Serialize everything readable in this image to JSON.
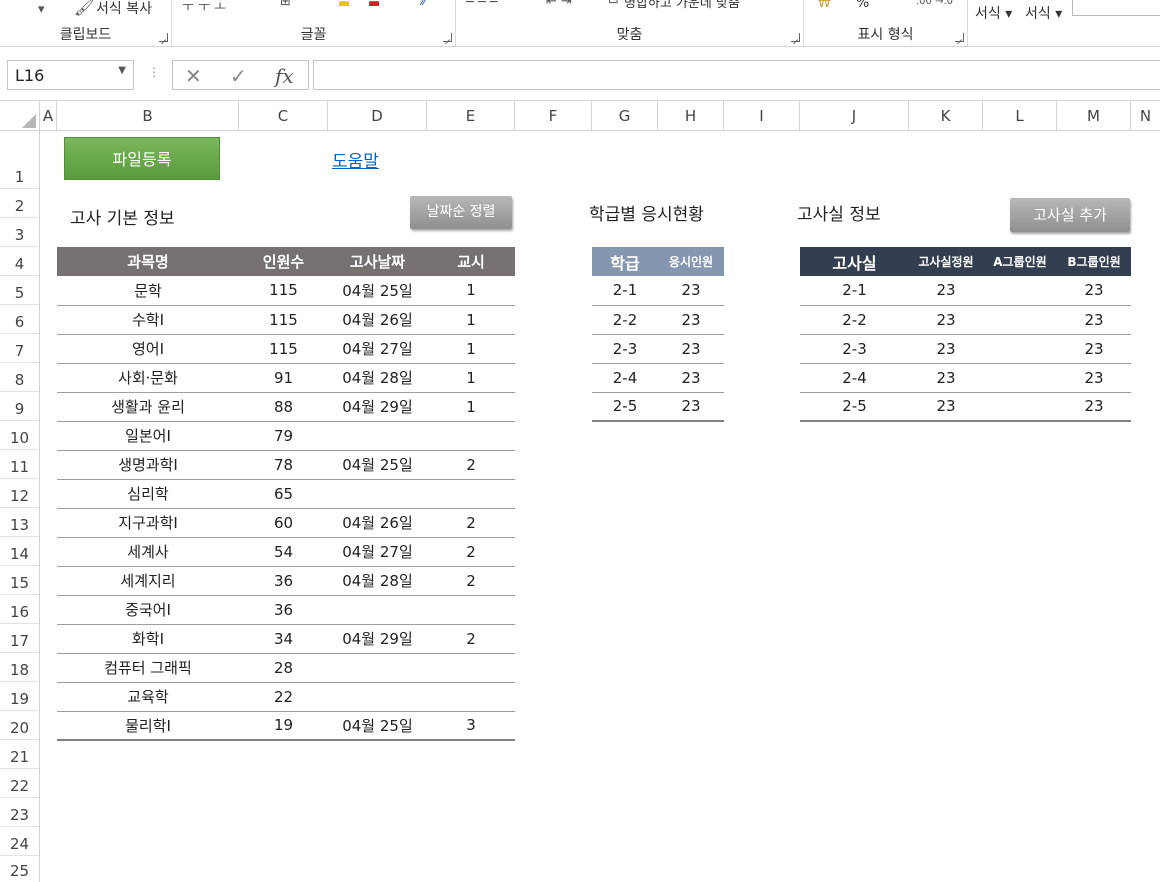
{
  "ribbon": {
    "clipboard_label": "클립보드",
    "font_label": "글꼴",
    "align_label": "맞춤",
    "number_label": "표시 형식",
    "format_painter": "서식 복사",
    "style1": "서식",
    "style2": "서식",
    "merge_label": "병합하고 가운데 맞춤",
    "percent": "%"
  },
  "formula_bar": {
    "name_box": "L16",
    "formula": ""
  },
  "columns": [
    "A",
    "B",
    "C",
    "D",
    "E",
    "F",
    "G",
    "H",
    "I",
    "J",
    "K",
    "L",
    "M",
    "N"
  ],
  "rows": [
    "1",
    "2",
    "3",
    "4",
    "5",
    "6",
    "7",
    "8",
    "9",
    "10",
    "11",
    "12",
    "13",
    "14",
    "15",
    "16",
    "17",
    "18",
    "19",
    "20",
    "21",
    "22",
    "23",
    "24",
    "25"
  ],
  "sheet": {
    "register_button": "파일등록",
    "help_link": "도움말",
    "exam_info_title": "고사 기본 정보",
    "sort_button": "날짜순 정렬",
    "class_status_title": "학급별 응시현황",
    "room_info_title": "고사실 정보",
    "add_room_button": "고사실 추가"
  },
  "exam_table": {
    "headers": [
      "과목명",
      "인원수",
      "고사날짜",
      "교시"
    ],
    "rows": [
      [
        "문학",
        "115",
        "04월 25일",
        "1"
      ],
      [
        "수학Ⅰ",
        "115",
        "04월 26일",
        "1"
      ],
      [
        "영어Ⅰ",
        "115",
        "04월 27일",
        "1"
      ],
      [
        "사회·문화",
        "91",
        "04월 28일",
        "1"
      ],
      [
        "생활과 윤리",
        "88",
        "04월 29일",
        "1"
      ],
      [
        "일본어Ⅰ",
        "79",
        "",
        ""
      ],
      [
        "생명과학Ⅰ",
        "78",
        "04월 25일",
        "2"
      ],
      [
        "심리학",
        "65",
        "",
        ""
      ],
      [
        "지구과학Ⅰ",
        "60",
        "04월 26일",
        "2"
      ],
      [
        "세계사",
        "54",
        "04월 27일",
        "2"
      ],
      [
        "세계지리",
        "36",
        "04월 28일",
        "2"
      ],
      [
        "중국어Ⅰ",
        "36",
        "",
        ""
      ],
      [
        "화학Ⅰ",
        "34",
        "04월 29일",
        "2"
      ],
      [
        "컴퓨터 그래픽",
        "28",
        "",
        ""
      ],
      [
        "교육학",
        "22",
        "",
        ""
      ],
      [
        "물리학Ⅰ",
        "19",
        "04월 25일",
        "3"
      ]
    ]
  },
  "class_table": {
    "headers": [
      "학급",
      "응시인원"
    ],
    "rows": [
      [
        "2-1",
        "23"
      ],
      [
        "2-2",
        "23"
      ],
      [
        "2-3",
        "23"
      ],
      [
        "2-4",
        "23"
      ],
      [
        "2-5",
        "23"
      ]
    ]
  },
  "room_table": {
    "headers": [
      "고사실",
      "고사실정원",
      "A그룹인원",
      "B그룹인원"
    ],
    "rows": [
      [
        "2-1",
        "23",
        "",
        "23"
      ],
      [
        "2-2",
        "23",
        "",
        "23"
      ],
      [
        "2-3",
        "23",
        "",
        "23"
      ],
      [
        "2-4",
        "23",
        "",
        "23"
      ],
      [
        "2-5",
        "23",
        "",
        "23"
      ]
    ]
  }
}
